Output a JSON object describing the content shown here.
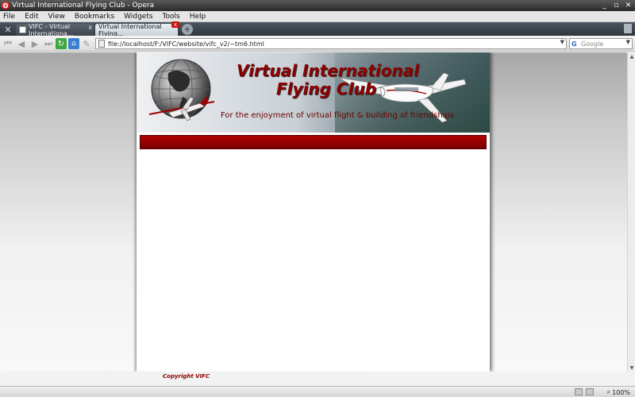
{
  "window": {
    "title": "Virtual International Flying Club - Opera",
    "controls": {
      "minimize": "_",
      "maximize": "▫",
      "close": "✕"
    }
  },
  "menu": [
    "File",
    "Edit",
    "View",
    "Bookmarks",
    "Widgets",
    "Tools",
    "Help"
  ],
  "tabs": [
    {
      "label": "VIFC - Virtual Internationa...",
      "active": false
    },
    {
      "label": "Virtual International Flying...",
      "active": true
    }
  ],
  "address": {
    "url": "file://localhost/F:/VIFC/website/vifc_v2/~tm6.html",
    "search_placeholder": "Google"
  },
  "page": {
    "title_line1": "Virtual International",
    "title_line2": "Flying Club",
    "tagline": "For the enjoyment of virtual flight & building of friendships",
    "copyright": "Copyright VIFC"
  },
  "status": {
    "zoom": "100%"
  },
  "colors": {
    "brand_red": "#8b0000",
    "nav_bar": "#a00000"
  }
}
